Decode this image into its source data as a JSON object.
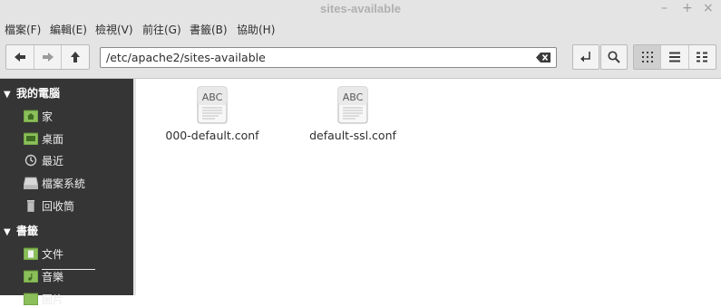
{
  "window": {
    "title": "sites-available",
    "minimize_glyph": "–",
    "maximize_glyph": "+",
    "close_glyph": "×"
  },
  "menu": {
    "items": [
      "檔案(F)",
      "編輯(E)",
      "檢視(V)",
      "前往(G)",
      "書籤(B)",
      "協助(H)"
    ]
  },
  "toolbar": {
    "back_icon": "arrow-left-icon",
    "forward_icon": "arrow-right-icon",
    "up_icon": "arrow-up-icon",
    "location": "/etc/apache2/sites-available",
    "clear_icon": "backspace-icon",
    "toggle_location_icon": "return-icon",
    "search_icon": "search-icon",
    "view_modes": [
      "icon-view-icon",
      "list-view-icon",
      "compact-view-icon"
    ],
    "active_view": "icon-view-icon"
  },
  "sidebar": {
    "sections": [
      {
        "label": "我的電腦",
        "items": [
          {
            "label": "家",
            "icon": "home-folder-icon"
          },
          {
            "label": "桌面",
            "icon": "desktop-folder-icon"
          },
          {
            "label": "最近",
            "icon": "recent-icon"
          },
          {
            "label": "檔案系統",
            "icon": "drive-icon",
            "selected": true
          },
          {
            "label": "回收筒",
            "icon": "trash-icon"
          }
        ]
      },
      {
        "label": "書籤",
        "items": [
          {
            "label": "文件",
            "icon": "documents-folder-icon"
          },
          {
            "label": "音樂",
            "icon": "music-folder-icon"
          },
          {
            "label": "圖片",
            "icon": "pictures-folder-icon"
          }
        ]
      }
    ]
  },
  "files": [
    {
      "name": "000-default.conf",
      "icon_text": "ABC"
    },
    {
      "name": "default-ssl.conf",
      "icon_text": "ABC"
    }
  ],
  "colors": {
    "sidebar_bg": "#353535",
    "chrome_bg": "#e4e4e4",
    "folder_green": "#8bbf5a"
  }
}
